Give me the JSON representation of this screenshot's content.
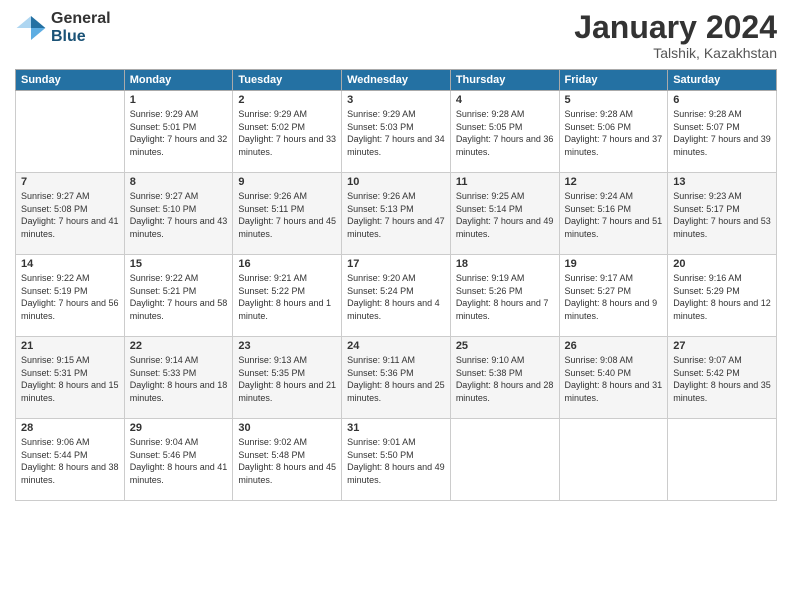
{
  "logo": {
    "general": "General",
    "blue": "Blue"
  },
  "title": {
    "month": "January 2024",
    "location": "Talshik, Kazakhstan"
  },
  "weekdays": [
    "Sunday",
    "Monday",
    "Tuesday",
    "Wednesday",
    "Thursday",
    "Friday",
    "Saturday"
  ],
  "weeks": [
    [
      {
        "day": "",
        "sunrise": "",
        "sunset": "",
        "daylight": ""
      },
      {
        "day": "1",
        "sunrise": "Sunrise: 9:29 AM",
        "sunset": "Sunset: 5:01 PM",
        "daylight": "Daylight: 7 hours and 32 minutes."
      },
      {
        "day": "2",
        "sunrise": "Sunrise: 9:29 AM",
        "sunset": "Sunset: 5:02 PM",
        "daylight": "Daylight: 7 hours and 33 minutes."
      },
      {
        "day": "3",
        "sunrise": "Sunrise: 9:29 AM",
        "sunset": "Sunset: 5:03 PM",
        "daylight": "Daylight: 7 hours and 34 minutes."
      },
      {
        "day": "4",
        "sunrise": "Sunrise: 9:28 AM",
        "sunset": "Sunset: 5:05 PM",
        "daylight": "Daylight: 7 hours and 36 minutes."
      },
      {
        "day": "5",
        "sunrise": "Sunrise: 9:28 AM",
        "sunset": "Sunset: 5:06 PM",
        "daylight": "Daylight: 7 hours and 37 minutes."
      },
      {
        "day": "6",
        "sunrise": "Sunrise: 9:28 AM",
        "sunset": "Sunset: 5:07 PM",
        "daylight": "Daylight: 7 hours and 39 minutes."
      }
    ],
    [
      {
        "day": "7",
        "sunrise": "Sunrise: 9:27 AM",
        "sunset": "Sunset: 5:08 PM",
        "daylight": "Daylight: 7 hours and 41 minutes."
      },
      {
        "day": "8",
        "sunrise": "Sunrise: 9:27 AM",
        "sunset": "Sunset: 5:10 PM",
        "daylight": "Daylight: 7 hours and 43 minutes."
      },
      {
        "day": "9",
        "sunrise": "Sunrise: 9:26 AM",
        "sunset": "Sunset: 5:11 PM",
        "daylight": "Daylight: 7 hours and 45 minutes."
      },
      {
        "day": "10",
        "sunrise": "Sunrise: 9:26 AM",
        "sunset": "Sunset: 5:13 PM",
        "daylight": "Daylight: 7 hours and 47 minutes."
      },
      {
        "day": "11",
        "sunrise": "Sunrise: 9:25 AM",
        "sunset": "Sunset: 5:14 PM",
        "daylight": "Daylight: 7 hours and 49 minutes."
      },
      {
        "day": "12",
        "sunrise": "Sunrise: 9:24 AM",
        "sunset": "Sunset: 5:16 PM",
        "daylight": "Daylight: 7 hours and 51 minutes."
      },
      {
        "day": "13",
        "sunrise": "Sunrise: 9:23 AM",
        "sunset": "Sunset: 5:17 PM",
        "daylight": "Daylight: 7 hours and 53 minutes."
      }
    ],
    [
      {
        "day": "14",
        "sunrise": "Sunrise: 9:22 AM",
        "sunset": "Sunset: 5:19 PM",
        "daylight": "Daylight: 7 hours and 56 minutes."
      },
      {
        "day": "15",
        "sunrise": "Sunrise: 9:22 AM",
        "sunset": "Sunset: 5:21 PM",
        "daylight": "Daylight: 7 hours and 58 minutes."
      },
      {
        "day": "16",
        "sunrise": "Sunrise: 9:21 AM",
        "sunset": "Sunset: 5:22 PM",
        "daylight": "Daylight: 8 hours and 1 minute."
      },
      {
        "day": "17",
        "sunrise": "Sunrise: 9:20 AM",
        "sunset": "Sunset: 5:24 PM",
        "daylight": "Daylight: 8 hours and 4 minutes."
      },
      {
        "day": "18",
        "sunrise": "Sunrise: 9:19 AM",
        "sunset": "Sunset: 5:26 PM",
        "daylight": "Daylight: 8 hours and 7 minutes."
      },
      {
        "day": "19",
        "sunrise": "Sunrise: 9:17 AM",
        "sunset": "Sunset: 5:27 PM",
        "daylight": "Daylight: 8 hours and 9 minutes."
      },
      {
        "day": "20",
        "sunrise": "Sunrise: 9:16 AM",
        "sunset": "Sunset: 5:29 PM",
        "daylight": "Daylight: 8 hours and 12 minutes."
      }
    ],
    [
      {
        "day": "21",
        "sunrise": "Sunrise: 9:15 AM",
        "sunset": "Sunset: 5:31 PM",
        "daylight": "Daylight: 8 hours and 15 minutes."
      },
      {
        "day": "22",
        "sunrise": "Sunrise: 9:14 AM",
        "sunset": "Sunset: 5:33 PM",
        "daylight": "Daylight: 8 hours and 18 minutes."
      },
      {
        "day": "23",
        "sunrise": "Sunrise: 9:13 AM",
        "sunset": "Sunset: 5:35 PM",
        "daylight": "Daylight: 8 hours and 21 minutes."
      },
      {
        "day": "24",
        "sunrise": "Sunrise: 9:11 AM",
        "sunset": "Sunset: 5:36 PM",
        "daylight": "Daylight: 8 hours and 25 minutes."
      },
      {
        "day": "25",
        "sunrise": "Sunrise: 9:10 AM",
        "sunset": "Sunset: 5:38 PM",
        "daylight": "Daylight: 8 hours and 28 minutes."
      },
      {
        "day": "26",
        "sunrise": "Sunrise: 9:08 AM",
        "sunset": "Sunset: 5:40 PM",
        "daylight": "Daylight: 8 hours and 31 minutes."
      },
      {
        "day": "27",
        "sunrise": "Sunrise: 9:07 AM",
        "sunset": "Sunset: 5:42 PM",
        "daylight": "Daylight: 8 hours and 35 minutes."
      }
    ],
    [
      {
        "day": "28",
        "sunrise": "Sunrise: 9:06 AM",
        "sunset": "Sunset: 5:44 PM",
        "daylight": "Daylight: 8 hours and 38 minutes."
      },
      {
        "day": "29",
        "sunrise": "Sunrise: 9:04 AM",
        "sunset": "Sunset: 5:46 PM",
        "daylight": "Daylight: 8 hours and 41 minutes."
      },
      {
        "day": "30",
        "sunrise": "Sunrise: 9:02 AM",
        "sunset": "Sunset: 5:48 PM",
        "daylight": "Daylight: 8 hours and 45 minutes."
      },
      {
        "day": "31",
        "sunrise": "Sunrise: 9:01 AM",
        "sunset": "Sunset: 5:50 PM",
        "daylight": "Daylight: 8 hours and 49 minutes."
      },
      {
        "day": "",
        "sunrise": "",
        "sunset": "",
        "daylight": ""
      },
      {
        "day": "",
        "sunrise": "",
        "sunset": "",
        "daylight": ""
      },
      {
        "day": "",
        "sunrise": "",
        "sunset": "",
        "daylight": ""
      }
    ]
  ]
}
